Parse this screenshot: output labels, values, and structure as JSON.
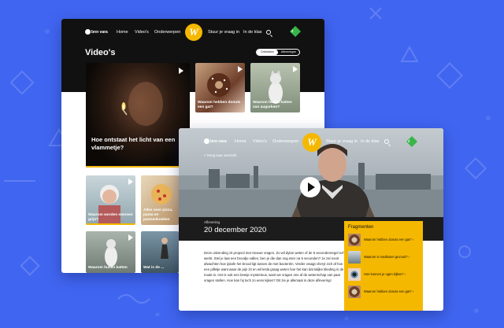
{
  "colors": {
    "background": "#4065f0",
    "accent": "#f5b800",
    "dark": "#111111"
  },
  "back_window": {
    "logo": "bnn vara",
    "nav": [
      "Home",
      "Video's",
      "Onderwerpen",
      "Stuur je vraag in",
      "In de klas"
    ],
    "badge_letter": "W",
    "heading": "Video's",
    "toggle": [
      "Onthekken",
      "Afleveringen"
    ],
    "featured_caption": "Hoe ontstaat het licht van een vlammetje?",
    "tiles": [
      {
        "caption": "Waarom hebben donuts een gat?"
      },
      {
        "caption": "Waarom huilen katten van augurken?"
      },
      {
        "caption": "Waarom worden mensen grijs?"
      },
      {
        "caption": "Alles over pizza, pasta en pannenkoeken"
      },
      {
        "caption": "Waarom huilen katten"
      },
      {
        "caption": "Wat is de ..."
      }
    ]
  },
  "front_window": {
    "logo": "bnn vara",
    "nav": [
      "Home",
      "Video's",
      "Onderwerpen",
      "Stuur je vraag in",
      "In de klas"
    ],
    "badge_letter": "W",
    "back_link": "< Terug naar overzicht",
    "label": "Aflevering",
    "title": "20 december 2020",
    "body": "Deze uitzending zit propvol met nieuwe vragen. Zo wil dylan weten of de 5 secondenregel echt werkt. Stel je laat een broodje vallen, ben je die dan nog eten na 5 seconden? Je zal nooit afwachten hoe ijstafe het brood ligt tussen de met bacteriën. Verder vraagt cheryl zich af hoe een pilletje want waar de pijn zit en wil tesla graag weten hoe het kan dat talijke klieding in de mode is. Het is ook een beetje mysterieus, want we vragen ons af de wetenschap van paar vragen stellen. Hoe kan hij toch zo eens kijken? Dit zie je allemaal in deze aflevering!",
    "fragments_title": "Fragmenten",
    "fragments": [
      {
        "text": "Waarom hebben donuts een gat?"
      },
      {
        "text": "Waarom is meditaren gezond?"
      },
      {
        "text": "Hoe kunnen je ogen kijken?"
      },
      {
        "text": "Waarom hebben donuts een gat?"
      }
    ]
  }
}
